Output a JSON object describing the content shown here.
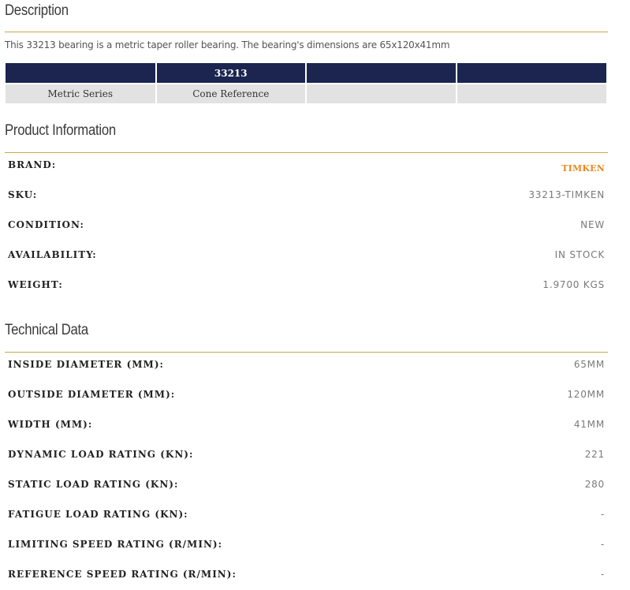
{
  "description": {
    "title": "Description",
    "text": "This 33213 bearing is a metric taper roller bearing. The bearing's dimensions are 65x120x41mm"
  },
  "spec_table": {
    "header": [
      "",
      "33213",
      "",
      ""
    ],
    "row": [
      "Metric Series",
      "Cone Reference",
      "",
      ""
    ]
  },
  "product_info": {
    "title": "Product Information",
    "rows": [
      {
        "label": "BRAND:",
        "value": "TIMKEN"
      },
      {
        "label": "SKU:",
        "value": "33213-TIMKEN"
      },
      {
        "label": "CONDITION:",
        "value": "NEW"
      },
      {
        "label": "AVAILABILITY:",
        "value": "IN STOCK"
      },
      {
        "label": "WEIGHT:",
        "value": "1.9700 KGS"
      }
    ]
  },
  "technical_data": {
    "title": "Technical Data",
    "rows": [
      {
        "label": "INSIDE DIAMETER (MM):",
        "value": "65MM"
      },
      {
        "label": "OUTSIDE DIAMETER (MM):",
        "value": "120MM"
      },
      {
        "label": "WIDTH (MM):",
        "value": "41MM"
      },
      {
        "label": "DYNAMIC LOAD RATING (KN):",
        "value": "221"
      },
      {
        "label": "STATIC LOAD RATING (KN):",
        "value": "280"
      },
      {
        "label": "FATIGUE LOAD RATING (KN):",
        "value": "-"
      },
      {
        "label": "LIMITING SPEED RATING (R/MIN):",
        "value": "-"
      },
      {
        "label": "REFERENCE SPEED RATING (R/MIN):",
        "value": "-"
      }
    ]
  },
  "colors": {
    "accent_rule": "#c9a84a",
    "table_header": "#1b2550",
    "table_body": "#e2e2e2",
    "brand_value": "#e8891f"
  }
}
